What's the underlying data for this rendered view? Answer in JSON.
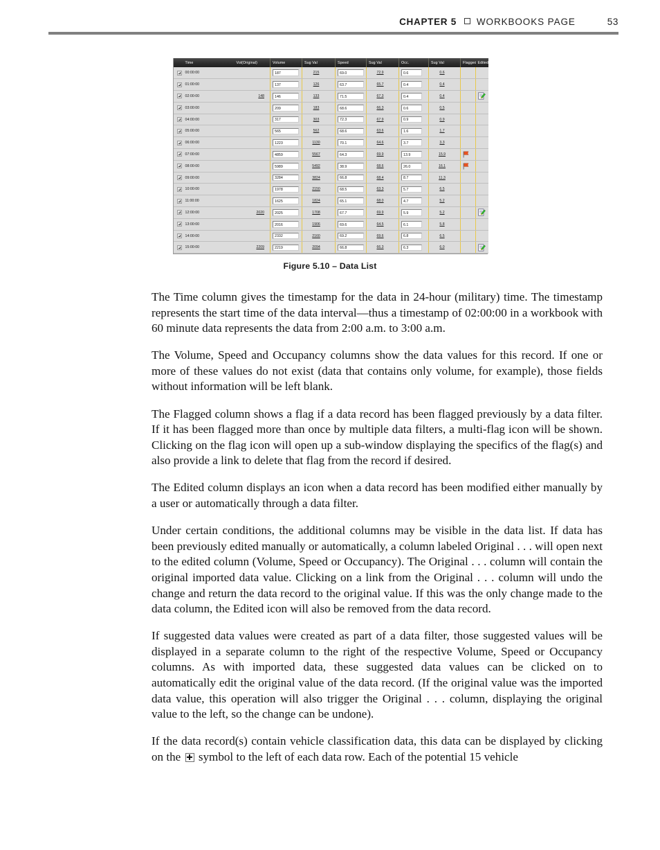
{
  "header": {
    "chapter": "CHAPTER 5",
    "square_icon": "square-bullet-icon",
    "title": "WORKBOOKS PAGE",
    "page_number": "53"
  },
  "figure": {
    "caption": "Figure 5.10 – Data List",
    "columns": [
      "",
      "Time",
      "Vol(Original)",
      "Volume",
      "Sug Val",
      "Speed",
      "Sug Val",
      "Occ.",
      "Sug Val",
      "Flagged",
      "Edited"
    ],
    "rows": [
      {
        "time": "00:00:00",
        "vol_original": "",
        "volume": "187",
        "vol_sug": "215",
        "speed": "69.0",
        "speed_sug": "72.9",
        "occ": "0.6",
        "occ_sug": "0.6",
        "flagged": "",
        "edited": ""
      },
      {
        "time": "01:00:00",
        "vol_original": "",
        "volume": "137",
        "vol_sug": "126",
        "speed": "63.7",
        "speed_sug": "65.7",
        "occ": "0.4",
        "occ_sug": "0.4",
        "flagged": "",
        "edited": ""
      },
      {
        "time": "02:00:00",
        "vol_original": "148",
        "volume": "146",
        "vol_sug": "133",
        "speed": "71.5",
        "speed_sug": "67.3",
        "occ": "0.4",
        "occ_sug": "0.4",
        "flagged": "",
        "edited": "edited-icon"
      },
      {
        "time": "03:00:00",
        "vol_original": "",
        "volume": "209",
        "vol_sug": "183",
        "speed": "68.6",
        "speed_sug": "66.3",
        "occ": "0.6",
        "occ_sug": "0.5",
        "flagged": "",
        "edited": ""
      },
      {
        "time": "04:00:00",
        "vol_original": "",
        "volume": "317",
        "vol_sug": "303",
        "speed": "72.3",
        "speed_sug": "67.9",
        "occ": "0.9",
        "occ_sug": "0.9",
        "flagged": "",
        "edited": ""
      },
      {
        "time": "05:00:00",
        "vol_original": "",
        "volume": "565",
        "vol_sug": "562",
        "speed": "68.6",
        "speed_sug": "63.6",
        "occ": "1.6",
        "occ_sug": "1.7",
        "flagged": "",
        "edited": ""
      },
      {
        "time": "06:00:00",
        "vol_original": "",
        "volume": "1223",
        "vol_sug": "1130",
        "speed": "70.1",
        "speed_sug": "64.6",
        "occ": "3.7",
        "occ_sug": "3.3",
        "flagged": "",
        "edited": ""
      },
      {
        "time": "07:00:00",
        "vol_original": "",
        "volume": "4859",
        "vol_sug": "5567",
        "speed": "64.3",
        "speed_sug": "69.9",
        "occ": "13.9",
        "occ_sug": "15.9",
        "flagged": "flag-icon",
        "edited": ""
      },
      {
        "time": "08:00:00",
        "vol_original": "",
        "volume": "5989",
        "vol_sug": "5492",
        "speed": "38.9",
        "speed_sug": "68.6",
        "occ": "26.0",
        "occ_sug": "16.1",
        "flagged": "flag-icon",
        "edited": ""
      },
      {
        "time": "09:00:00",
        "vol_original": "",
        "volume": "3284",
        "vol_sug": "3824",
        "speed": "66.8",
        "speed_sug": "68.4",
        "occ": "8.7",
        "occ_sug": "11.3",
        "flagged": "",
        "edited": ""
      },
      {
        "time": "10:00:00",
        "vol_original": "",
        "volume": "1978",
        "vol_sug": "2150",
        "speed": "68.5",
        "speed_sug": "63.3",
        "occ": "5.7",
        "occ_sug": "6.5",
        "flagged": "",
        "edited": ""
      },
      {
        "time": "11:00:00",
        "vol_original": "",
        "volume": "1625",
        "vol_sug": "1824",
        "speed": "65.1",
        "speed_sug": "68.0",
        "occ": "4.7",
        "occ_sug": "5.2",
        "flagged": "",
        "edited": ""
      },
      {
        "time": "12:00:00",
        "vol_original": "2020",
        "volume": "2025",
        "vol_sug": "1708",
        "speed": "67.7",
        "speed_sug": "69.9",
        "occ": "5.9",
        "occ_sug": "5.2",
        "flagged": "",
        "edited": "edited-icon"
      },
      {
        "time": "13:00:00",
        "vol_original": "",
        "volume": "2016",
        "vol_sug": "1906",
        "speed": "69.6",
        "speed_sug": "64.5",
        "occ": "6.1",
        "occ_sug": "5.8",
        "flagged": "",
        "edited": ""
      },
      {
        "time": "14:00:00",
        "vol_original": "",
        "volume": "2332",
        "vol_sug": "2160",
        "speed": "69.2",
        "speed_sug": "69.6",
        "occ": "6.8",
        "occ_sug": "6.5",
        "flagged": "",
        "edited": ""
      },
      {
        "time": "15:00:00",
        "vol_original": "2209",
        "volume": "2219",
        "vol_sug": "2094",
        "speed": "66.8",
        "speed_sug": "66.3",
        "occ": "6.3",
        "occ_sug": "6.0",
        "flagged": "",
        "edited": "edited-icon"
      }
    ],
    "expander_icon": "plus-expander-icon"
  },
  "body": {
    "p1": "The Time column gives the timestamp for the data in 24-hour (military) time. The timestamp represents the start time of the data interval—thus a timestamp of 02:00:00 in a workbook with 60 minute data represents the data from 2:00 a.m. to 3:00 a.m.",
    "p2": "The Volume, Speed and Occupancy columns show the data values for this record. If one or more of these values do not exist (data that contains only volume, for example), those fields without information will be left blank.",
    "p3": "The Flagged column shows a flag if a data record has been flagged previously by a data filter. If it has been flagged more than once by multiple data filters, a multi-flag icon will be shown. Clicking on the flag icon will open up a sub-window displaying the specifics of the flag(s) and also provide a link to delete that flag from the record if desired.",
    "p4": "The Edited column displays an icon when a data record has been modified either manually by a user or automatically through a data filter.",
    "p5": "Under certain conditions, the additional columns may be visible in the data list. If data has been previously edited manually or automatically, a column labeled Original . . . will open next to the edited column (Volume, Speed or Occupancy). The Original . . . column will contain the original imported data value. Clicking on a link from the Original . . . column will undo the change and return the data record to the original value. If this was the only change made to the data column, the Edited icon will also be removed from the data record.",
    "p6": "If suggested data values were created as part of a data filter, those suggested values will be displayed in a separate column to the right of the respective Volume, Speed or Occupancy columns. As with imported data, these suggested data values can be clicked on to automatically edit the original value of the data record. (If the original value was the imported data value, this operation will also trigger the Original . . . column, displaying the original value to the left, so the change can be undone).",
    "p7_before": "If the data record(s) contain vehicle classification data, this data can be displayed by clicking on the",
    "p7_after": "symbol to the left of each data row. Each of the potential 15 vehicle"
  },
  "colors": {
    "header_rule": "#808080",
    "table_header_bg": "#2e2e2e",
    "row_bg": "#dcdcdc",
    "separator_yellow": "#e8c84a",
    "flag_red": "#e8521f",
    "edit_green": "#2fbb2f"
  }
}
